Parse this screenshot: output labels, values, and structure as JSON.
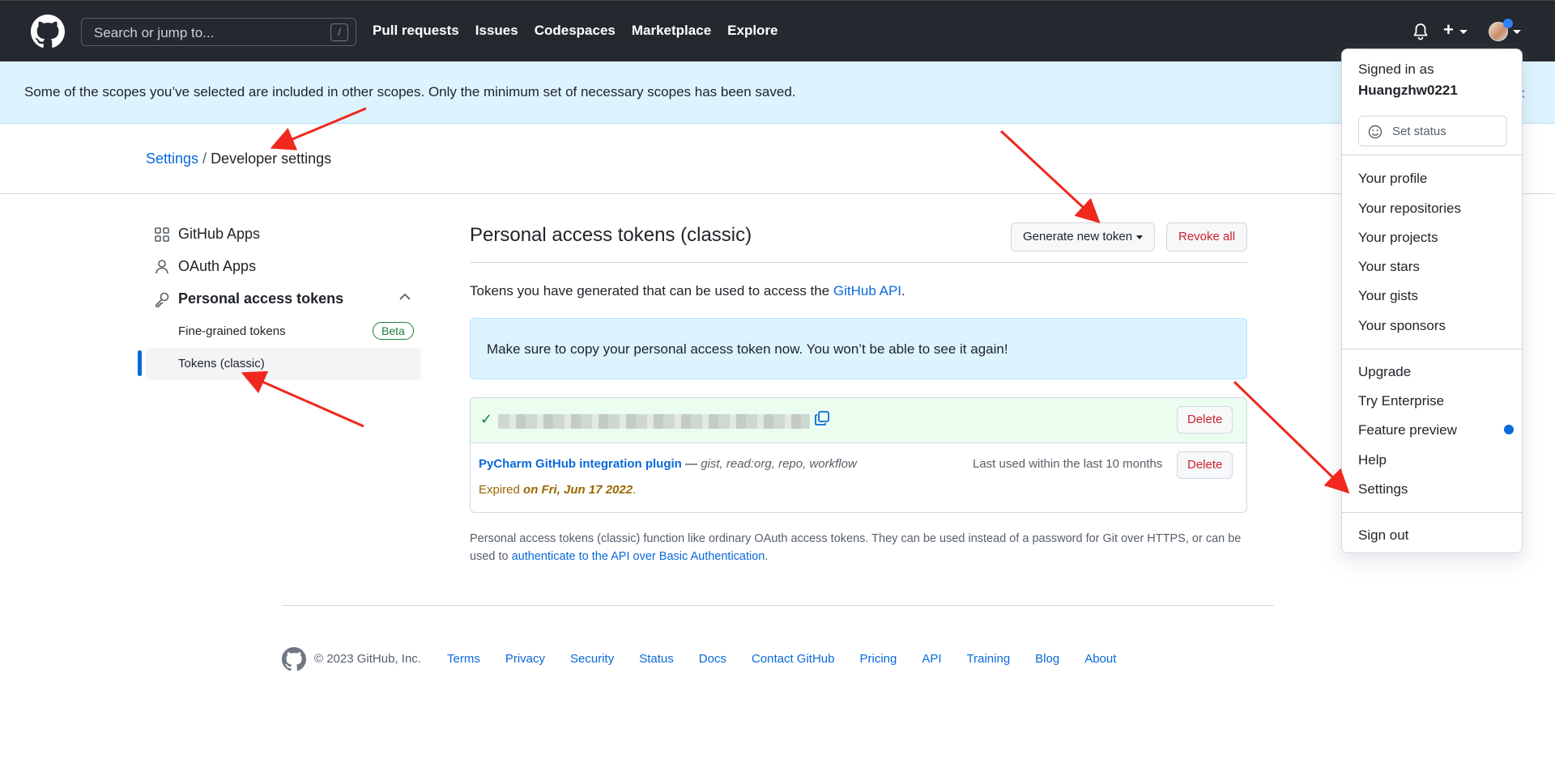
{
  "header": {
    "search_placeholder": "Search or jump to...",
    "search_shortcut": "/",
    "nav": [
      "Pull requests",
      "Issues",
      "Codespaces",
      "Marketplace",
      "Explore"
    ],
    "new_label": "+"
  },
  "flash": {
    "message": "Some of the scopes you’ve selected are included in other scopes. Only the minimum set of necessary scopes has been saved.",
    "close": "‹"
  },
  "breadcrumb": {
    "root": "Settings",
    "separator": "/",
    "current": "Developer settings"
  },
  "sidebar": {
    "github_apps": "GitHub Apps",
    "oauth_apps": "OAuth Apps",
    "pat": "Personal access tokens",
    "fine_grained": "Fine-grained tokens",
    "beta": "Beta",
    "classic": "Tokens (classic)"
  },
  "main": {
    "title": "Personal access tokens (classic)",
    "generate_button": "Generate new token",
    "revoke_button": "Revoke all",
    "desc_prefix": "Tokens you have generated that can be used to access the ",
    "desc_link": "GitHub API",
    "desc_suffix": ".",
    "notice": "Make sure to copy your personal access token now. You won’t be able to see it again!",
    "new_token": {
      "check": "✓",
      "delete": "Delete"
    },
    "token": {
      "name": "PyCharm GitHub integration plugin",
      "dash": " — ",
      "scopes": "gist, read:org, repo, workflow",
      "last_used": "Last used within the last 10 months",
      "expired_prefix": "Expired ",
      "expired_date": "on Fri, Jun 17 2022",
      "expired_suffix": ".",
      "delete": "Delete"
    },
    "footnote_text": "Personal access tokens (classic) function like ordinary OAuth access tokens. They can be used instead of a password for Git over HTTPS, or can be used to ",
    "footnote_link": "authenticate to the API over Basic Authentication",
    "footnote_suffix": "."
  },
  "footer": {
    "copyright": "© 2023 GitHub, Inc.",
    "links": [
      "Terms",
      "Privacy",
      "Security",
      "Status",
      "Docs",
      "Contact GitHub",
      "Pricing",
      "API",
      "Training",
      "Blog",
      "About"
    ]
  },
  "dropdown": {
    "signed_in_as": "Signed in as",
    "username": "Huangzhw0221",
    "set_status": "Set status",
    "profile": "Your profile",
    "repositories": "Your repositories",
    "projects": "Your projects",
    "stars": "Your stars",
    "gists": "Your gists",
    "sponsors": "Your sponsors",
    "upgrade": "Upgrade",
    "enterprise": "Try Enterprise",
    "feature_preview": "Feature preview",
    "help": "Help",
    "settings": "Settings",
    "sign_out": "Sign out"
  },
  "colors": {
    "header_bg": "#24292f",
    "link": "#0969da",
    "danger": "#cf222e",
    "success": "#1a7f37",
    "annotation_arrow": "#f0281e"
  }
}
